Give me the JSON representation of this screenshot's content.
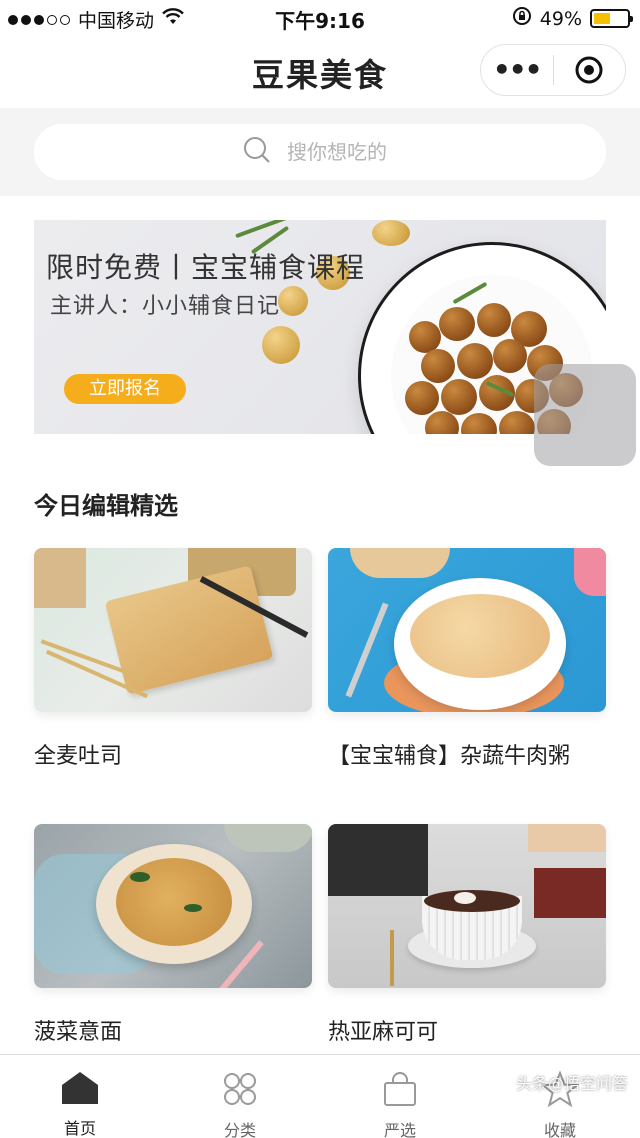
{
  "status_bar": {
    "carrier": "中国移动",
    "time": "下午9:16",
    "battery_pct": "49%",
    "battery_level": 0.49,
    "wifi_icon": "wifi-icon",
    "lock_icon": "orientation-lock-icon"
  },
  "nav": {
    "title": "豆果美食",
    "more_icon": "more-dots-icon",
    "close_icon": "target-circle-icon"
  },
  "search": {
    "placeholder": "搜你想吃的",
    "icon": "search-icon"
  },
  "banner": {
    "title": "限时免费丨宝宝辅食课程",
    "subtitle": "主讲人：小小辅食日记",
    "button": "立即报名",
    "accent": "#f5ad1c"
  },
  "section": {
    "title": "今日编辑精选"
  },
  "recipes": [
    {
      "name": "全麦吐司"
    },
    {
      "name": "【宝宝辅食】杂蔬牛肉粥"
    },
    {
      "name": "菠菜意面"
    },
    {
      "name": "热亚麻可可"
    }
  ],
  "tabs": [
    {
      "label": "首页",
      "icon": "home-icon",
      "active": true
    },
    {
      "label": "分类",
      "icon": "category-grid-icon",
      "active": false
    },
    {
      "label": "严选",
      "icon": "shopping-bag-icon",
      "active": false
    },
    {
      "label": "收藏",
      "icon": "star-icon",
      "active": false
    }
  ],
  "watermark": "头条@悟空问答"
}
